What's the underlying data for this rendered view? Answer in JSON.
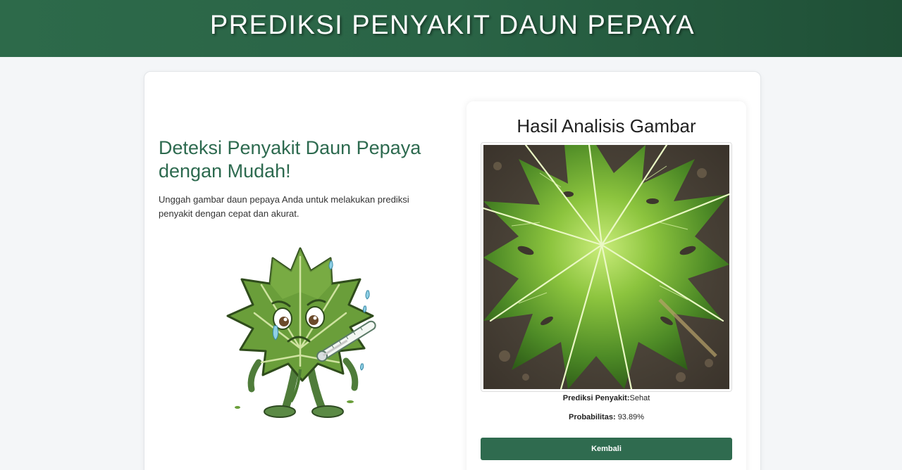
{
  "header": {
    "title": "PREDIKSI PENYAKIT DAUN PEPAYA"
  },
  "intro": {
    "heading": "Deteksi Penyakit Daun Pepaya dengan Mudah!",
    "description": "Unggah gambar daun pepaya Anda untuk melakukan prediksi penyakit dengan cepat dan akurat.",
    "mascot_icon": "sick-papaya-leaf-mascot-icon"
  },
  "result": {
    "title": "Hasil Analisis Gambar",
    "prediction_label": "Prediksi Penyakit:",
    "prediction_value": "Sehat",
    "probability_label": "Probabilitas:",
    "probability_value": "93.89%",
    "back_button": "Kembali"
  },
  "colors": {
    "header_bg": "#2d6a4a",
    "accent": "#2d6a4f",
    "button": "#2f6b4f"
  }
}
